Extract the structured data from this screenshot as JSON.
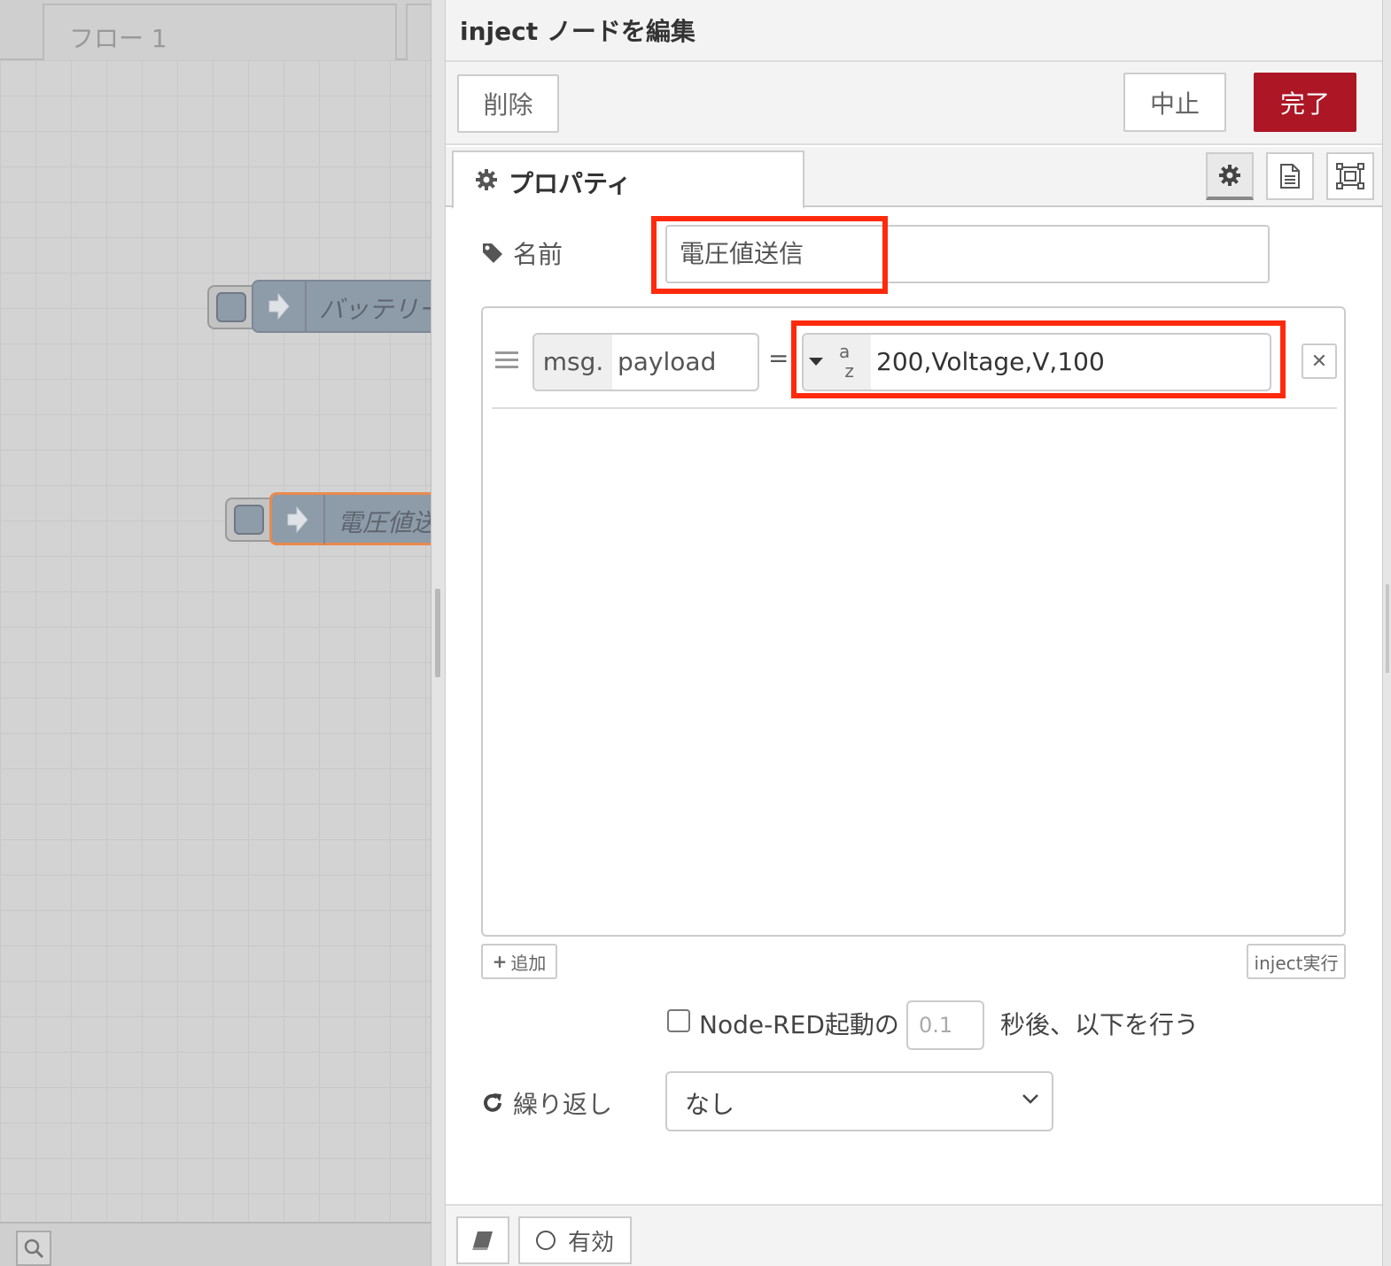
{
  "workspace": {
    "tabs": [
      {
        "label": "フロー 1"
      }
    ],
    "nodes": [
      {
        "label": "バッテリー"
      },
      {
        "label": "電圧値送信"
      }
    ],
    "search_icon": "search-icon"
  },
  "editor": {
    "title": "inject ノードを編集",
    "buttons": {
      "delete": "削除",
      "cancel": "中止",
      "done": "完了"
    },
    "tabs": {
      "properties": "プロパティ",
      "icons": [
        "gear-icon",
        "document-icon",
        "frame-icon"
      ]
    },
    "name": {
      "label": "名前",
      "value": "電圧値送信"
    },
    "props": [
      {
        "prefix": "msg.",
        "key": "payload",
        "type_icon": "a z",
        "value": "200,Voltage,V,100"
      }
    ],
    "add_label": "追加",
    "inject_now_label": "inject実行",
    "once": {
      "label": "Node-RED起動の",
      "delay_placeholder": "0.1",
      "suffix": "秒後、以下を行う",
      "checked": false
    },
    "repeat": {
      "label": "繰り返し",
      "value": "なし"
    },
    "footer": {
      "enabled_label": "有効"
    },
    "colors": {
      "done_button": "#ad1625",
      "highlight": "#ff2a0d"
    }
  }
}
